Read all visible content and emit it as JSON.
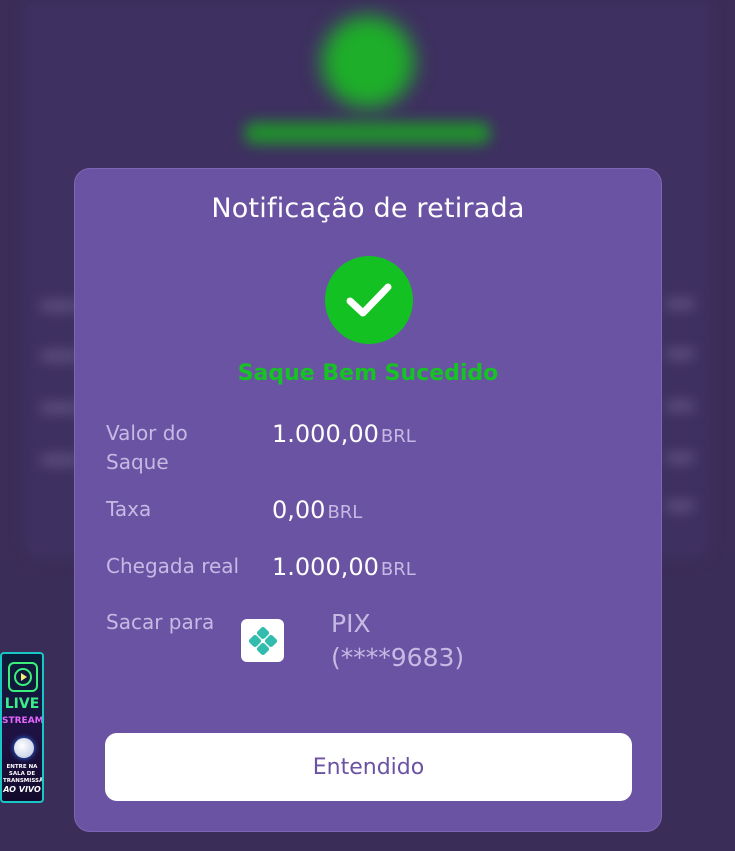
{
  "modal": {
    "title": "Notificação de retirada",
    "status": "Saque Bem Sucedido",
    "rows": [
      {
        "label": "Valor do Saque",
        "amount": "1.000,00",
        "currency": "BRL"
      },
      {
        "label": "Taxa",
        "amount": "0,00",
        "currency": "BRL"
      },
      {
        "label": "Chegada real",
        "amount": "1.000,00",
        "currency": "BRL"
      }
    ],
    "destination": {
      "label": "Sacar para",
      "method": "PIX",
      "account": "(****9683)",
      "icon": "pix-logo-icon"
    },
    "button_label": "Entendido"
  },
  "live_banner": {
    "live": "LIVE",
    "stream": "STREAM",
    "caption": "ENTRE NA SALA DE TRANSMISSÃO",
    "aovivo": "AO VIVO"
  },
  "colors": {
    "modal_bg": "#6b53a3",
    "success_green": "#13c222",
    "backdrop": "#3a2d57",
    "label_text": "#c6b9e4",
    "pix_teal": "#32bcad"
  }
}
